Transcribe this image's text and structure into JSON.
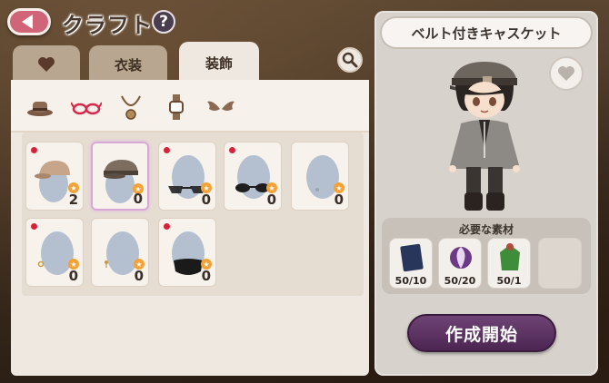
{
  "header": {
    "title": "クラフト",
    "help_label": "?"
  },
  "tabs": [
    {
      "label": "",
      "icon": "heart-icon",
      "active": false
    },
    {
      "label": "衣装",
      "active": false
    },
    {
      "label": "装飾",
      "active": true
    }
  ],
  "categories": [
    "hat-icon",
    "glasses-icon",
    "necklace-icon",
    "watch-icon",
    "wings-icon"
  ],
  "items": [
    {
      "type": "cap-beige",
      "count": "2",
      "new": true
    },
    {
      "type": "casquette",
      "count": "0",
      "new": false,
      "selected": true
    },
    {
      "type": "cat-eye-glasses",
      "count": "0",
      "new": true
    },
    {
      "type": "sunglasses",
      "count": "0",
      "new": true
    },
    {
      "type": "earring",
      "count": "0",
      "new": false
    },
    {
      "type": "earring-gold",
      "count": "0",
      "new": true
    },
    {
      "type": "earring-gold-2",
      "count": "0",
      "new": false
    },
    {
      "type": "black-mask",
      "count": "0",
      "new": true
    }
  ],
  "detail": {
    "item_name": "ベルト付きキャスケット",
    "materials_title": "必要な素材",
    "materials": [
      {
        "name": "navy-fabric",
        "count": "50/10"
      },
      {
        "name": "purple-ribbon",
        "count": "50/20"
      },
      {
        "name": "green-jacket",
        "count": "50/1"
      },
      {
        "name": "empty",
        "count": ""
      }
    ],
    "craft_label": "作成開始"
  },
  "colors": {
    "accent_purple": "#4c2552",
    "back_pink": "#d0657a",
    "new_dot": "#d5243a"
  }
}
